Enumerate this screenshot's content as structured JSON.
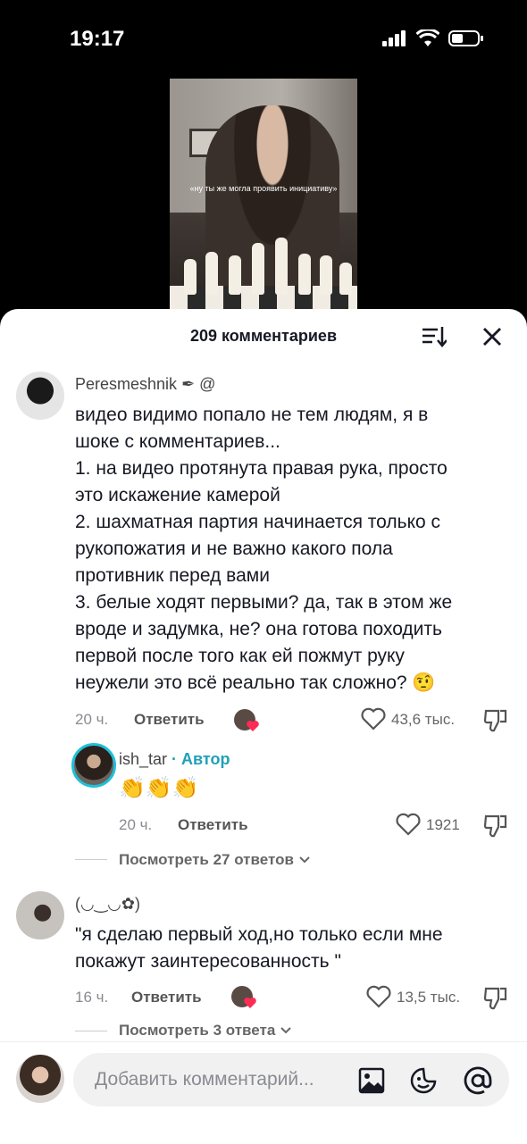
{
  "status": {
    "time": "19:17"
  },
  "video": {
    "caption": "«ну ты же могла проявить инициативу»"
  },
  "sheet": {
    "title": "209 комментариев"
  },
  "comments": [
    {
      "username": "Peresmeshnik",
      "username_suffix": "@",
      "text_lines": [
        "видео видимо попало не тем людям, я в",
        "шоке с комментариев...",
        "1. на видео протянута правая рука, просто",
        "это искажение камерой",
        "2. шахматная партия начинается только с",
        "рукопожатия и не важно какого пола",
        "противник перед вами",
        "3. белые ходят первыми? да, так в этом же",
        "вроде и задумка, не? она готова походить",
        "первой после того как ей пожмут руку",
        "неужели это всё реально так сложно?"
      ],
      "time": "20 ч.",
      "reply_label": "Ответить",
      "likes": "43,6 тыс."
    },
    {
      "username": "ish_tar",
      "author_tag": "· Автор",
      "text": "👏👏👏",
      "time": "20 ч.",
      "reply_label": "Ответить",
      "likes": "1921"
    },
    {
      "view_more": "Посмотреть 27 ответов"
    },
    {
      "username": "(◡‿◡✿)",
      "text_lines": [
        "\"я сделаю первый ход,но только если мне",
        "покажут заинтересованность \""
      ],
      "time": "16 ч.",
      "reply_label": "Ответить",
      "likes": "13,5 тыс."
    },
    {
      "view_more": "Посмотреть 3 ответа"
    }
  ],
  "bottom": {
    "placeholder": "Добавить комментарий..."
  },
  "colors": {
    "accent": "#20a0b8",
    "like_badge": "#fe2c55"
  },
  "icons": [
    "signal-icon",
    "wifi-icon",
    "battery-icon",
    "sort-icon",
    "close-icon",
    "heart-icon",
    "dislike-icon",
    "chevron-down-icon",
    "image-icon",
    "emoji-icon",
    "mention-icon"
  ]
}
